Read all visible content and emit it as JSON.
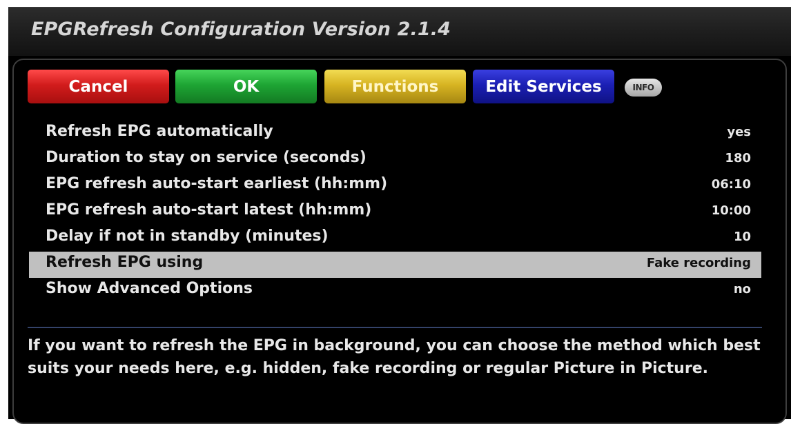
{
  "window": {
    "title": "EPGRefresh Configuration Version 2.1.4"
  },
  "buttons": {
    "red": "Cancel",
    "green": "OK",
    "yellow": "Functions",
    "blue": "Edit Services",
    "info": "INFO"
  },
  "settings": [
    {
      "label": "Refresh EPG automatically",
      "value": "yes"
    },
    {
      "label": "Duration to stay on service (seconds)",
      "value": "180"
    },
    {
      "label": "EPG refresh auto-start earliest (hh:mm)",
      "value": "06:10"
    },
    {
      "label": "EPG refresh auto-start latest (hh:mm)",
      "value": "10:00"
    },
    {
      "label": "Delay if not in standby (minutes)",
      "value": "10"
    },
    {
      "label": "Refresh EPG using",
      "value": "Fake recording",
      "selected": true
    },
    {
      "label": "Show Advanced Options",
      "value": "no"
    }
  ],
  "description": "If you want to refresh the EPG in background, you can choose the method which best suits your needs here, e.g. hidden, fake recording or regular Picture in Picture.",
  "colors": {
    "red": "#d21c1c",
    "green": "#1ea534",
    "yellow": "#d7b422",
    "blue": "#1b1fb4",
    "selection": "#c0c0c0"
  },
  "icons": {
    "info": "info-icon"
  }
}
